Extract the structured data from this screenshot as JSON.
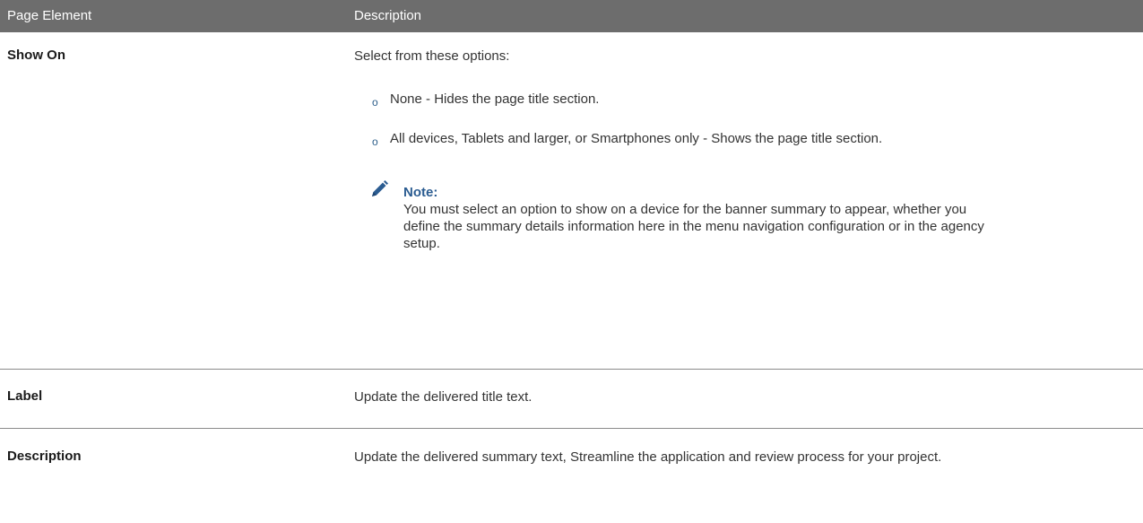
{
  "table": {
    "headers": [
      "Page Element",
      "Description"
    ],
    "show_on": {
      "element": "Show On",
      "intro": "Select from these options:",
      "options": [
        "None - Hides the page title section.",
        "All devices, Tablets and larger, or Smartphones only - Shows the page title section."
      ],
      "note": {
        "title": "Note:",
        "body": "You must select an option to show on a device for the banner summary to appear, whether you define the summary details information here in the menu navigation configuration or in the agency setup."
      }
    },
    "label": {
      "element": "Label",
      "description": "Update the delivered title text."
    },
    "description": {
      "element": "Description",
      "description": "Update the delivered summary text, Streamline the application and review process for your project."
    }
  },
  "colors": {
    "header_bg": "#6d6d6d",
    "note_title": "#2b5c91",
    "bullet": "#2d5f8b"
  },
  "icons": {
    "note": "pencil-icon",
    "bullet": "circle-bullet-icon"
  }
}
